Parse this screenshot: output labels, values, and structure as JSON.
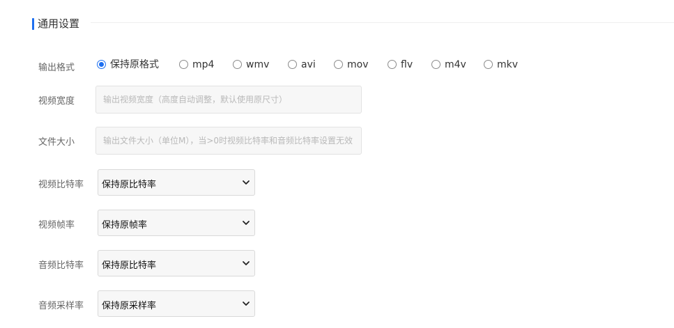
{
  "section": {
    "title": "通用设置",
    "accent_color": "#1e6ff0"
  },
  "output_format": {
    "label": "输出格式",
    "selected": "保持原格式",
    "options": [
      "保持原格式",
      "mp4",
      "wmv",
      "avi",
      "mov",
      "flv",
      "m4v",
      "mkv"
    ]
  },
  "video_width": {
    "label": "视频宽度",
    "value": "",
    "placeholder": "输出视频宽度（高度自动调整，默认使用原尺寸）"
  },
  "file_size": {
    "label": "文件大小",
    "value": "",
    "placeholder": "输出文件大小（单位M），当>0时视频比特率和音频比特率设置无效"
  },
  "video_bitrate": {
    "label": "视频比特率",
    "selected": "保持原比特率"
  },
  "video_framerate": {
    "label": "视频帧率",
    "selected": "保持原帧率"
  },
  "audio_bitrate": {
    "label": "音频比特率",
    "selected": "保持原比特率"
  },
  "audio_samplerate": {
    "label": "音频采样率",
    "selected": "保持原采样率"
  },
  "icons": {
    "select_chevron": "chevron-down-icon"
  }
}
